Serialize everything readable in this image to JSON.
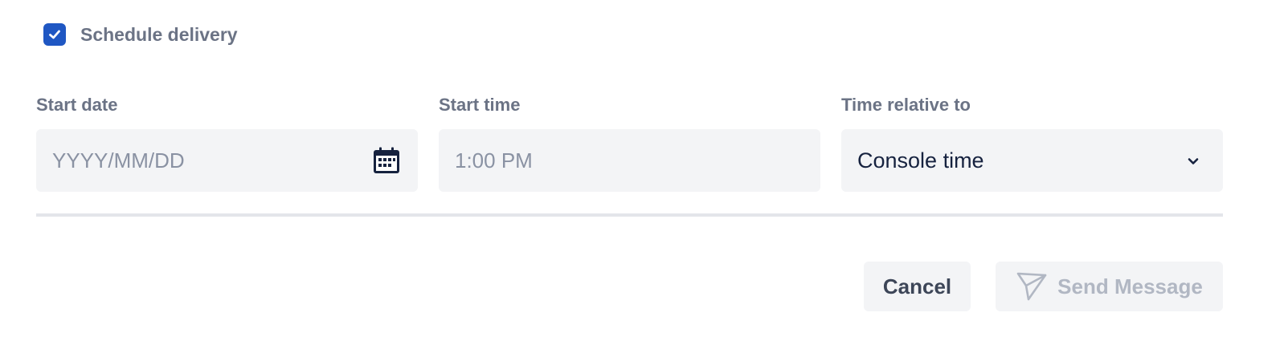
{
  "schedule": {
    "checkbox_label": "Schedule delivery",
    "checked": true
  },
  "start_date": {
    "label": "Start date",
    "placeholder": "YYYY/MM/DD",
    "value": "",
    "icon": "calendar-icon"
  },
  "start_time": {
    "label": "Start time",
    "placeholder": "1:00 PM",
    "value": ""
  },
  "time_relative": {
    "label": "Time relative to",
    "selected": "Console time",
    "icon": "chevron-down-icon"
  },
  "actions": {
    "cancel_label": "Cancel",
    "send_label": "Send Message",
    "send_icon": "send-icon",
    "send_disabled": true
  },
  "colors": {
    "accent": "#1f57c3",
    "label": "#6b7385",
    "field_bg": "#f3f4f6",
    "disabled_text": "#b1b7c3"
  }
}
